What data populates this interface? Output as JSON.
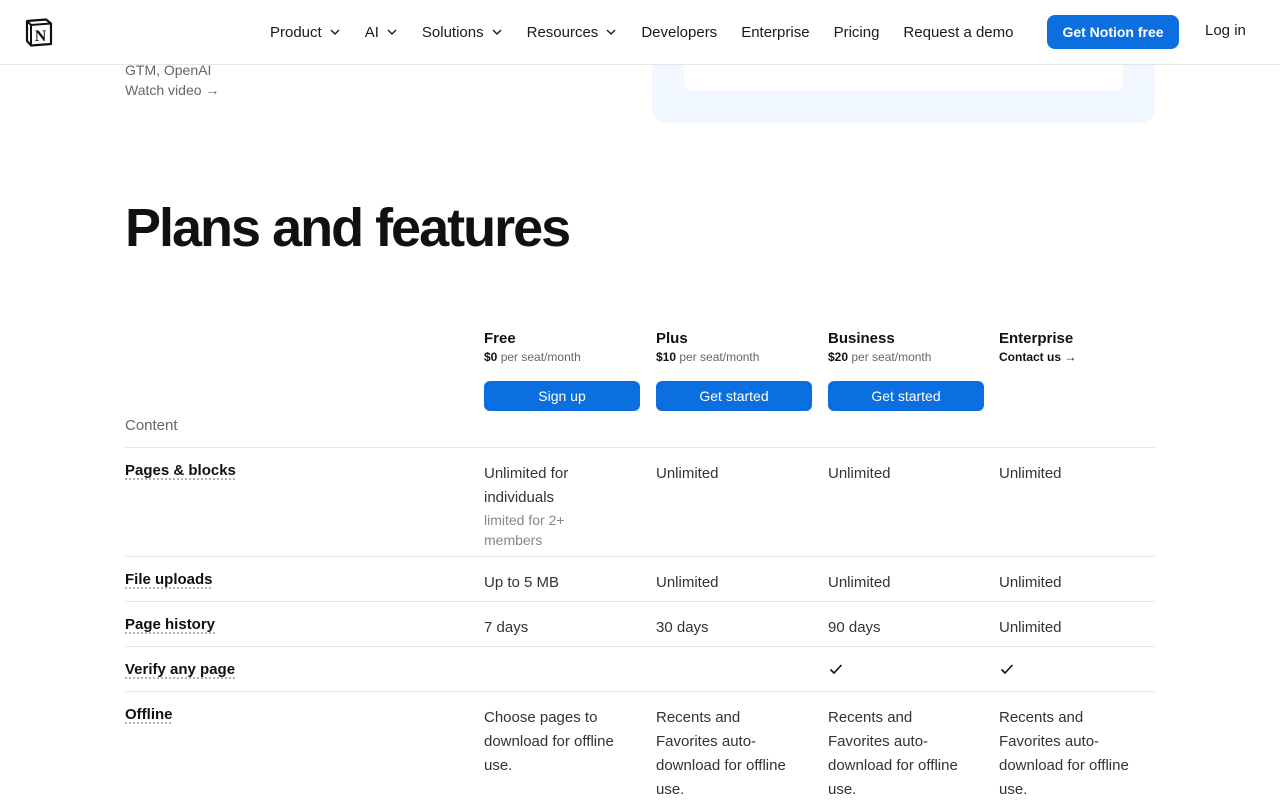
{
  "header": {
    "logo_letter": "N",
    "nav": [
      {
        "label": "Product",
        "dropdown": true
      },
      {
        "label": "AI",
        "dropdown": true
      },
      {
        "label": "Solutions",
        "dropdown": true
      },
      {
        "label": "Resources",
        "dropdown": true
      },
      {
        "label": "Developers",
        "dropdown": false
      },
      {
        "label": "Enterprise",
        "dropdown": false
      },
      {
        "label": "Pricing",
        "dropdown": false
      },
      {
        "label": "Request a demo",
        "dropdown": false
      }
    ],
    "cta_label": "Get Notion free",
    "login_label": "Log in",
    "accent_color": "#0b6fe0"
  },
  "testimonial": {
    "byline": "GTM, OpenAI",
    "watch_video": "Watch video →"
  },
  "title": "Plans and features",
  "plans": [
    {
      "name": "Free",
      "price": "$0",
      "unit": "per seat/month",
      "button": "Sign up"
    },
    {
      "name": "Plus",
      "price": "$10",
      "unit": "per seat/month",
      "button": "Get started"
    },
    {
      "name": "Business",
      "price": "$20",
      "unit": "per seat/month",
      "button": "Get started"
    },
    {
      "name": "Enterprise",
      "contact": "Contact us →"
    }
  ],
  "section_label": "Content",
  "rows": [
    {
      "feature": "Pages & blocks",
      "cells": [
        {
          "text": "Unlimited for individuals",
          "sub": "limited for 2+ members"
        },
        {
          "text": "Unlimited"
        },
        {
          "text": "Unlimited"
        },
        {
          "text": "Unlimited"
        }
      ]
    },
    {
      "feature": "File uploads",
      "cells": [
        {
          "text": "Up to 5 MB"
        },
        {
          "text": "Unlimited"
        },
        {
          "text": "Unlimited"
        },
        {
          "text": "Unlimited"
        }
      ]
    },
    {
      "feature": "Page history",
      "cells": [
        {
          "text": "7 days"
        },
        {
          "text": "30 days"
        },
        {
          "text": "90 days"
        },
        {
          "text": "Unlimited"
        }
      ]
    },
    {
      "feature": "Verify any page",
      "cells": [
        {
          "text": ""
        },
        {
          "text": ""
        },
        {
          "icon": "checkmark-icon"
        },
        {
          "icon": "checkmark-icon"
        }
      ]
    },
    {
      "feature": "Offline",
      "cells": [
        {
          "text": "Choose pages to download for offline use."
        },
        {
          "text": "Recents and Favorites auto-download for offline use."
        },
        {
          "text": "Recents and Favorites auto-download for offline use."
        },
        {
          "text": "Recents and Favorites auto-download for offline use."
        }
      ]
    }
  ]
}
